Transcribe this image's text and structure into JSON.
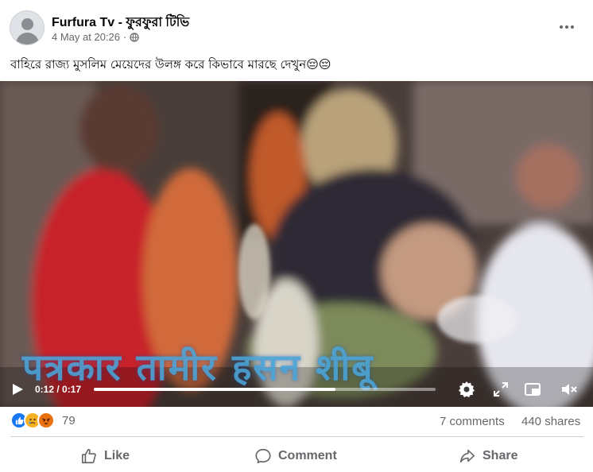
{
  "post": {
    "page_name": "Furfura Tv - ফুরফুরা টিভি",
    "date": "4 May at 20:26",
    "separator": "·",
    "privacy_icon": "globe-icon",
    "text": "বাহিরে রাজ্য মুসলিম মেয়েদের উলঙ্গ করে কিভাবে মারছে দেখুন😔😔"
  },
  "video": {
    "overlay_text": "पत्रकार तामीर हसन शीबू",
    "time_display": "0:12 / 0:17",
    "progress_fraction": 0.706,
    "controls": [
      "play-icon",
      "gear-icon",
      "fullscreen-icon",
      "picture-in-picture-icon",
      "mute-icon"
    ]
  },
  "engagement": {
    "reaction_icons": [
      "like-icon",
      "sad-icon",
      "angry-icon"
    ],
    "reaction_count": "79",
    "comments": "7 comments",
    "shares": "440 shares"
  },
  "actions": {
    "like": "Like",
    "comment": "Comment",
    "share": "Share"
  },
  "colors": {
    "text_secondary": "#65676b",
    "like_blue": "#1877f2",
    "overlay_blue": "#4aa3d8"
  }
}
